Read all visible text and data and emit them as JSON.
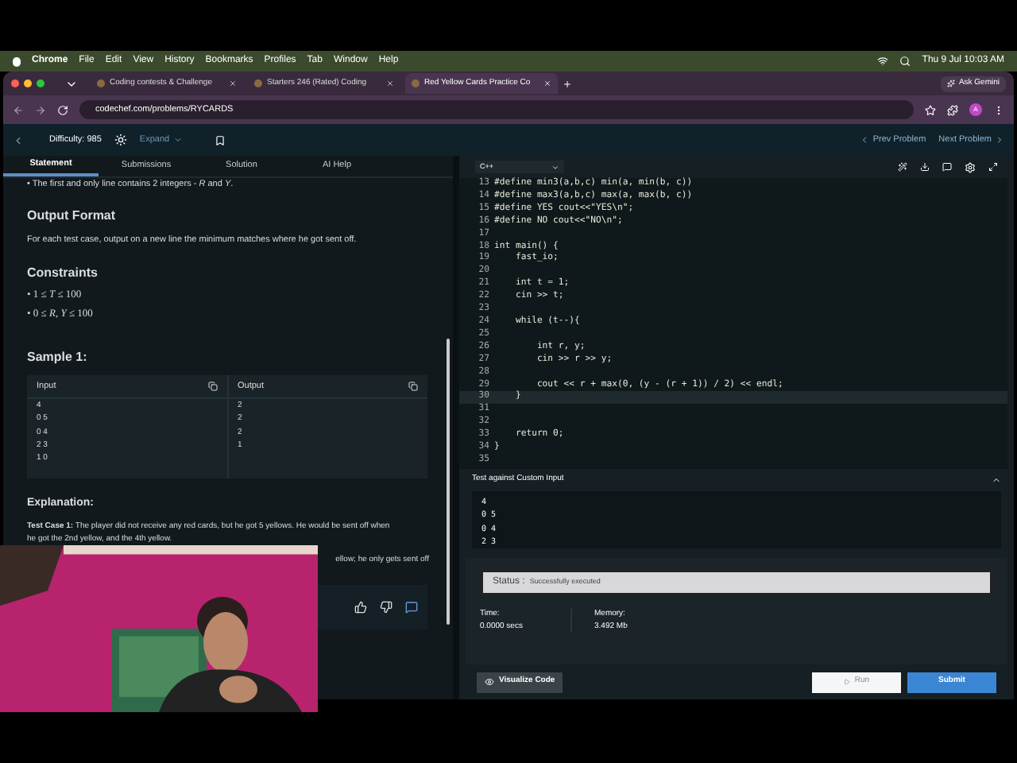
{
  "menu_bar": {
    "app": "Chrome",
    "items": [
      "File",
      "Edit",
      "View",
      "History",
      "Bookmarks",
      "Profiles",
      "Tab",
      "Window",
      "Help"
    ],
    "clock": "Thu 9 Jul  10:03 AM"
  },
  "browser_tabs": [
    {
      "title": "Coding contests & Challenge",
      "selected": false
    },
    {
      "title": "Starters 246 (Rated) Coding",
      "selected": false
    },
    {
      "title": "Red Yellow Cards Practice Co",
      "selected": true
    }
  ],
  "ask_button": "Ask Gemini",
  "address": "codechef.com/problems/RYCARDS",
  "avatar": "A",
  "header": {
    "difficulty": "Difficulty: 985",
    "expand": "Expand",
    "prev": "Prev Problem",
    "next": "Next Problem"
  },
  "problem_tabs": [
    {
      "label": "Statement",
      "selected": true
    },
    {
      "label": "Submissions",
      "selected": false
    },
    {
      "label": "Solution",
      "selected": false
    },
    {
      "label": "AI Help",
      "selected": false
    }
  ],
  "statement": {
    "input_line": "• The first and only line contains 2 integers - *R* and *Y*.",
    "output_heading": "Output Format",
    "output_text": "For each test case, output on a new line the minimum matches where he got sent off.",
    "constraints_heading": "Constraints",
    "constraints": [
      "• 1 ≤ *T* ≤ 100",
      "• 0 ≤ *R*, *Y* ≤ 100"
    ],
    "sample_heading": "Sample 1:",
    "input_label": "Input",
    "output_label": "Output",
    "sample_input": [
      "4",
      "0 5",
      "0 4",
      "2 3",
      "1 0"
    ],
    "sample_output": [
      "2",
      "2",
      "2",
      "1"
    ],
    "explanation_heading": "Explanation:",
    "explanation_1": "**Test Case 1:** The player did not receive any red cards, but he got 5 yellows. He would be sent off when",
    "explanation_1b": "he got the 2nd yellow, and the 4th yellow.",
    "explanation_2": "ellow; he only gets sent off"
  },
  "editor": {
    "language": "C++",
    "lines": [
      {
        "n": "13",
        "current": false,
        "text": "#define min3(a,b,c) min(a, min(b, c))"
      },
      {
        "n": "14",
        "current": false,
        "text": "#define max3(a,b,c) max(a, max(b, c))"
      },
      {
        "n": "15",
        "current": false,
        "text": "#define YES cout<<\"YES\\n\";"
      },
      {
        "n": "16",
        "current": false,
        "text": "#define NO cout<<\"NO\\n\";"
      },
      {
        "n": "17",
        "current": false
      },
      {
        "n": "18",
        "current": false,
        "text": "int main() {"
      },
      {
        "n": "19",
        "current": false,
        "text": "    fast_io;"
      },
      {
        "n": "20",
        "current": false
      },
      {
        "n": "21",
        "current": false,
        "text": "    int t = 1;"
      },
      {
        "n": "22",
        "current": false,
        "text": "    cin >> t;"
      },
      {
        "n": "23",
        "current": false
      },
      {
        "n": "24",
        "current": false,
        "text": "    while (t--){"
      },
      {
        "n": "25",
        "current": false
      },
      {
        "n": "26",
        "current": false,
        "text": "        int r, y;"
      },
      {
        "n": "27",
        "current": false,
        "text": "        cin >> r >> y;"
      },
      {
        "n": "28",
        "current": false
      },
      {
        "n": "29",
        "current": false,
        "text": "        cout << r + max(0, (y - (r + 1)) / 2) << endl;"
      },
      {
        "n": "30",
        "current": true,
        "text": "    }"
      },
      {
        "n": "31",
        "current": false
      },
      {
        "n": "32",
        "current": false
      },
      {
        "n": "33",
        "current": false,
        "text": "    return 0;"
      },
      {
        "n": "34",
        "current": false,
        "text": "}"
      },
      {
        "n": "35",
        "current": false
      }
    ]
  },
  "custom_input": {
    "title": "Test against Custom Input",
    "lines": [
      "4",
      "0 5",
      "0 4",
      "2 3"
    ]
  },
  "result": {
    "status_label": "Status :",
    "status": "Successfully executed",
    "time_label": "Time:",
    "time": "0.0000 secs",
    "memory_label": "Memory:",
    "memory": "3.492 Mb"
  },
  "buttons": {
    "visualize": "Visualize Code",
    "run": "Run",
    "submit": "Submit"
  }
}
